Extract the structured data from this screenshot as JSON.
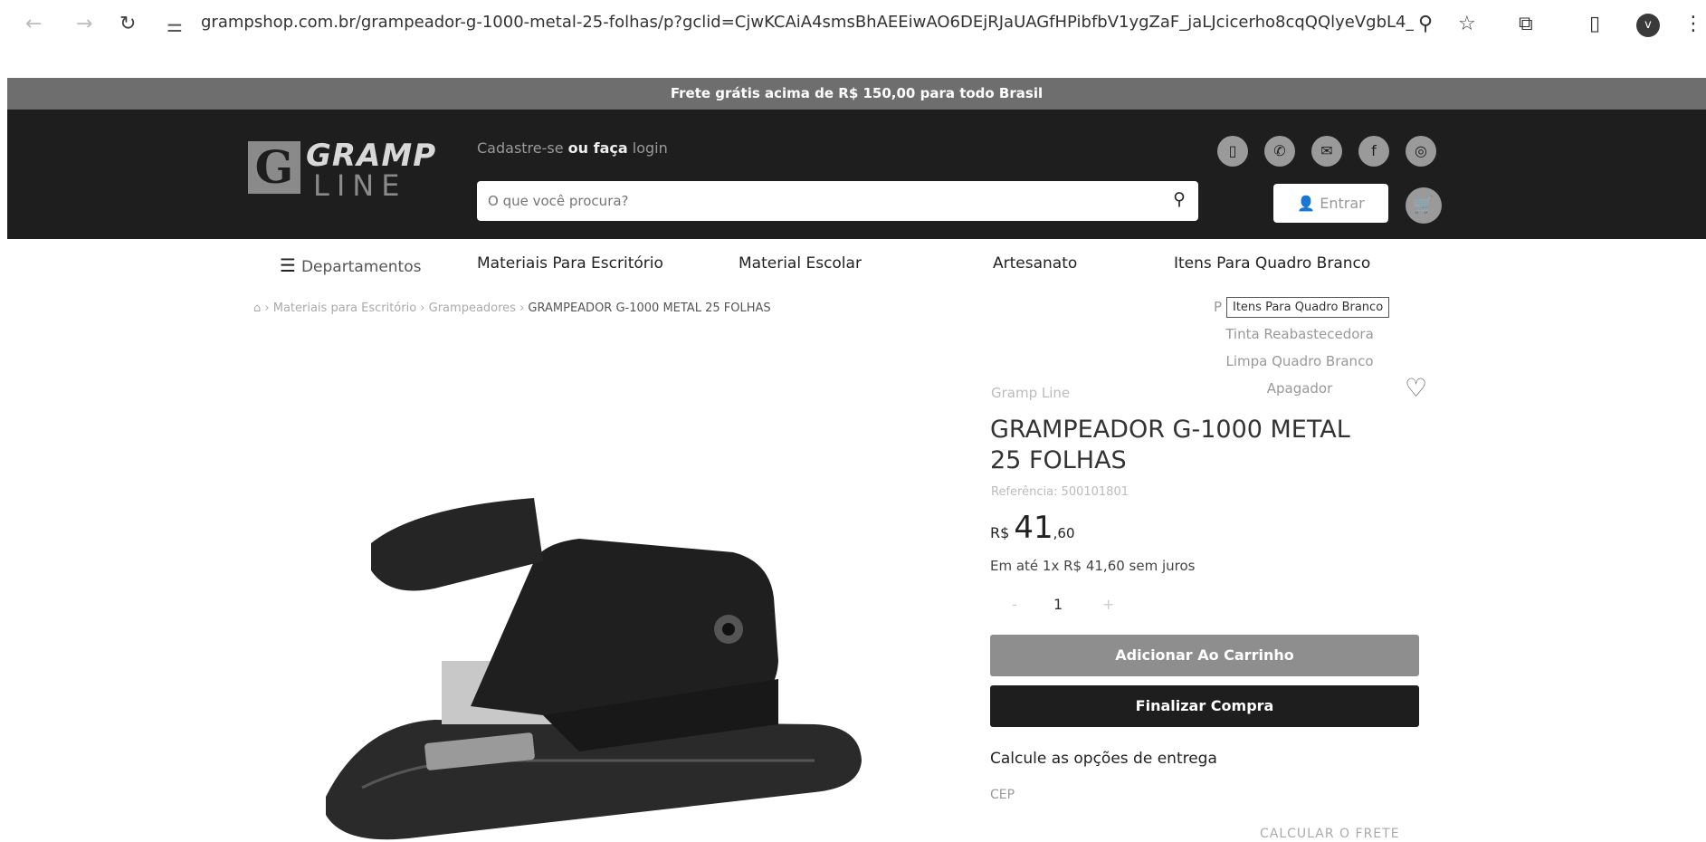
{
  "browser": {
    "url": "grampshop.com.br/grampeador-g-1000-metal-25-folhas/p?gclid=CjwKCAiA4smsBhAEEiwAO6DEjRJaUAGfHPibfbV1ygZaF_jaLJcicerho8cqQQlyeVgbL4__0c...",
    "profile_initial": "v"
  },
  "topbar": {
    "text": "Frete grátis acima de R$ 150,00 para todo Brasil"
  },
  "header": {
    "logo_top": "GRAMP",
    "logo_bottom": "LINE",
    "signup_prefix": "Cadastre-se",
    "signup_or": "ou faça",
    "signup_login": "login",
    "search_placeholder": "O que você procura?",
    "login_label": "Entrar"
  },
  "nav": {
    "departments": "Departamentos",
    "items": [
      "Materiais Para Escritório",
      "Material Escolar",
      "Artesanato",
      "Itens Para Quadro Branco"
    ]
  },
  "breadcrumb": {
    "items": [
      "Materiais para Escritório",
      "Grampeadores"
    ],
    "current": "GRAMPEADOR G-1000 METAL 25 FOLHAS"
  },
  "dropdown": {
    "items": [
      "P",
      "Tinta Reabastecedora",
      "Limpa Quadro Branco",
      "Apagador"
    ],
    "tooltip": "Itens Para Quadro Branco"
  },
  "product": {
    "brand": "Gramp Line",
    "title": "GRAMPEADOR G-1000 METAL 25 FOLHAS",
    "reference": "Referência: 500101801",
    "price_currency": "R$",
    "price_int": "41",
    "price_dec": ",60",
    "installments": "Em até 1x R$ 41,60 sem juros",
    "qty_minus": "-",
    "quantity": "1",
    "qty_plus": "+",
    "add_to_cart": "Adicionar Ao Carrinho",
    "buy_now": "Finalizar Compra",
    "shipping_title": "Calcule as opções de entrega",
    "cep_label": "CEP",
    "calc_shipping": "CALCULAR O FRETE"
  },
  "colors": {
    "header_bg": "#1e1e1e",
    "topbar_bg": "#6e6e6e",
    "add_btn": "#8e8e8e",
    "buy_btn": "#1e1e1e"
  }
}
